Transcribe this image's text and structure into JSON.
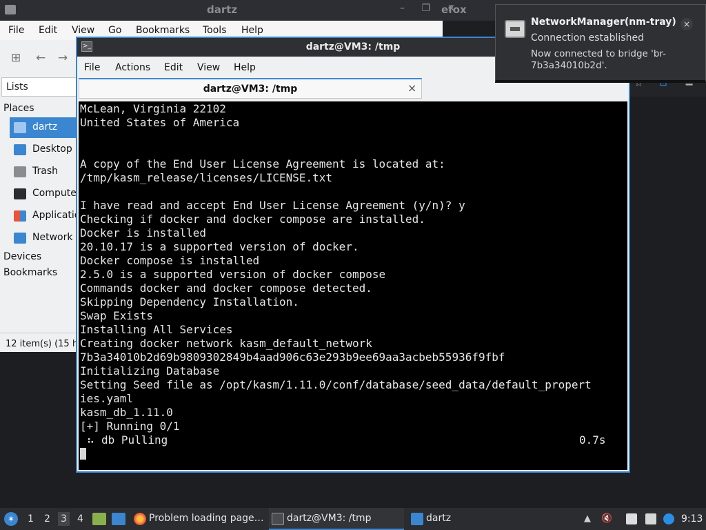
{
  "background": {
    "file_manager_title": "dartz",
    "firefox_title_fragment": "efox",
    "window_controls": "– ❐ ×"
  },
  "file_manager": {
    "menu": [
      "File",
      "Edit",
      "View",
      "Go",
      "Bookmarks",
      "Tools",
      "Help"
    ],
    "lists_selector": "Lists",
    "places_heading": "Places",
    "places": [
      "dartz",
      "Desktop",
      "Trash",
      "Computer",
      "Applications",
      "Network"
    ],
    "devices_heading": "Devices",
    "bookmarks_heading": "Bookmarks",
    "status": "12 item(s) (15 h"
  },
  "terminal": {
    "title": "dartz@VM3: /tmp",
    "menu": [
      "File",
      "Actions",
      "Edit",
      "View",
      "Help"
    ],
    "tab_label": "dartz@VM3: /tmp",
    "lines": [
      "McLean, Virginia 22102",
      "United States of America",
      "",
      "",
      "A copy of the End User License Agreement is located at:",
      "/tmp/kasm_release/licenses/LICENSE.txt",
      "",
      "I have read and accept End User License Agreement (y/n)? y",
      "Checking if docker and docker compose are installed.",
      "Docker is installed",
      "20.10.17 is a supported version of docker.",
      "Docker compose is installed",
      "2.5.0 is a supported version of docker compose",
      "Commands docker and docker compose detected.",
      "Skipping Dependency Installation.",
      "Swap Exists",
      "Installing All Services",
      "Creating docker network kasm_default_network",
      "7b3a34010b2d69b9809302849b4aad906c63e293b9ee69aa3acbeb55936f9fbf",
      "Initializing Database",
      "Setting Seed file as /opt/kasm/1.11.0/conf/database/seed_data/default_propert",
      "ies.yaml",
      "kasm_db_1.11.0",
      "[+] Running 0/1"
    ],
    "pull_line": " ⠦ db Pulling",
    "pull_time": "0.7s"
  },
  "notification": {
    "title": "NetworkManager(nm-tray)",
    "body1": "Connection established",
    "body2": "Now connected to bridge 'br-7b3a34010b2d'."
  },
  "taskbar": {
    "workspaces": [
      "1",
      "2",
      "3",
      "4"
    ],
    "tasks": [
      {
        "label": "Problem loading page…"
      },
      {
        "label": "dartz@VM3: /tmp"
      },
      {
        "label": "dartz"
      }
    ],
    "clock": "9:13"
  },
  "colors": {
    "accent": "#3a86d1",
    "terminal_bg": "#000000",
    "terminal_fg": "#e6e6e6",
    "panel_dark": "#2b2c30"
  }
}
